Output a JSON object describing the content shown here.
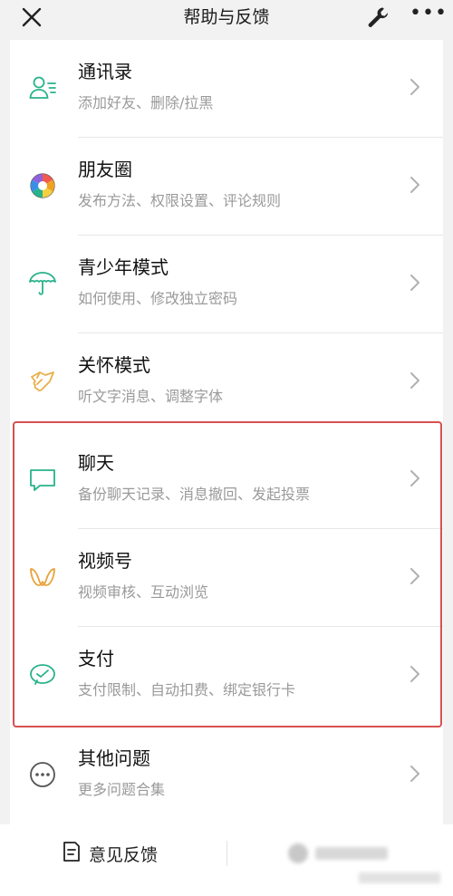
{
  "header": {
    "title": "帮助与反馈",
    "close_icon": "close-icon",
    "tool_icon": "wrench-icon",
    "more_label": "•••"
  },
  "items": [
    {
      "label": "通讯录",
      "desc": "添加好友、删除/拉黑",
      "icon": "contacts-icon",
      "color": "#29b28b"
    },
    {
      "label": "朋友圈",
      "desc": "发布方法、权限设置、评论规则",
      "icon": "moments-icon",
      "color": "#f0a322"
    },
    {
      "label": "青少年模式",
      "desc": "如何使用、修改独立密码",
      "icon": "umbrella-icon",
      "color": "#29b28b"
    },
    {
      "label": "关怀模式",
      "desc": "听文字消息、调整字体",
      "icon": "care-icon",
      "color": "#e9b04a"
    },
    {
      "label": "聊天",
      "desc": "备份聊天记录、消息撤回、发起投票",
      "icon": "chat-bubble-icon",
      "color": "#29b28b"
    },
    {
      "label": "视频号",
      "desc": "视频审核、互动浏览",
      "icon": "channels-icon",
      "color": "#e9a23b"
    },
    {
      "label": "支付",
      "desc": "支付限制、自动扣费、绑定银行卡",
      "icon": "payment-icon",
      "color": "#29b28b"
    },
    {
      "label": "其他问题",
      "desc": "更多问题合集",
      "icon": "more-circle-icon",
      "color": "#555555"
    }
  ],
  "footer": {
    "feedback_label": "意见反馈"
  },
  "colors": {
    "accent_green": "#29b28b",
    "highlight_red": "#d85050"
  }
}
